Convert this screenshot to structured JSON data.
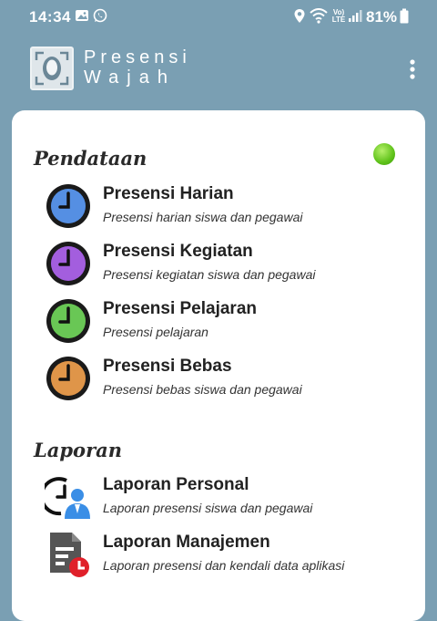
{
  "status_bar": {
    "time": "14:34",
    "signal_label": "Vo) LTE",
    "battery": "81%"
  },
  "app_bar": {
    "title_line1": "Presensi",
    "title_line2": "Wajah"
  },
  "colors": {
    "background": "#7a9fb3",
    "status_dot": "#5fc21a"
  },
  "sections": {
    "pendataan": {
      "title": "Pendataan",
      "items": [
        {
          "title": "Presensi Harian",
          "subtitle": "Presensi harian siswa dan pegawai",
          "icon": "clock-blue-icon"
        },
        {
          "title": "Presensi Kegiatan",
          "subtitle": "Presensi kegiatan siswa dan pegawai",
          "icon": "clock-purple-icon"
        },
        {
          "title": "Presensi Pelajaran",
          "subtitle": "Presensi pelajaran",
          "icon": "clock-green-icon"
        },
        {
          "title": "Presensi Bebas",
          "subtitle": "Presensi bebas siswa dan pegawai",
          "icon": "clock-orange-icon"
        }
      ]
    },
    "laporan": {
      "title": "Laporan",
      "items": [
        {
          "title": "Laporan Personal",
          "subtitle": "Laporan presensi siswa dan pegawai",
          "icon": "person-clock-icon"
        },
        {
          "title": "Laporan Manajemen",
          "subtitle": "Laporan presensi dan kendali data aplikasi",
          "icon": "document-clock-icon"
        }
      ]
    }
  }
}
